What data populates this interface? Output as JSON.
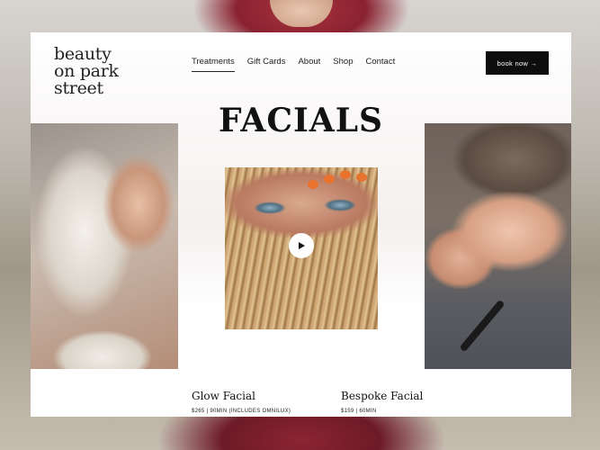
{
  "brand": {
    "logo_lines": [
      "beauty",
      "on park",
      "street"
    ]
  },
  "nav": {
    "items": [
      {
        "label": "Treatments",
        "active": true
      },
      {
        "label": "Gift Cards",
        "active": false
      },
      {
        "label": "About",
        "active": false
      },
      {
        "label": "Shop",
        "active": false
      },
      {
        "label": "Contact",
        "active": false
      }
    ]
  },
  "header": {
    "book_label": "book now →"
  },
  "hero": {
    "title": "FACIALS"
  },
  "media": {
    "play_icon": "play-icon"
  },
  "treatments": [
    {
      "name": "Glow Facial",
      "meta": "$265 | 90MIN (INCLUDES OMNILUX)"
    },
    {
      "name": "Bespoke Facial",
      "meta": "$159 | 60MIN"
    }
  ],
  "colors": {
    "button_bg": "#0d0d0d",
    "accent_orange": "#e8732e"
  }
}
